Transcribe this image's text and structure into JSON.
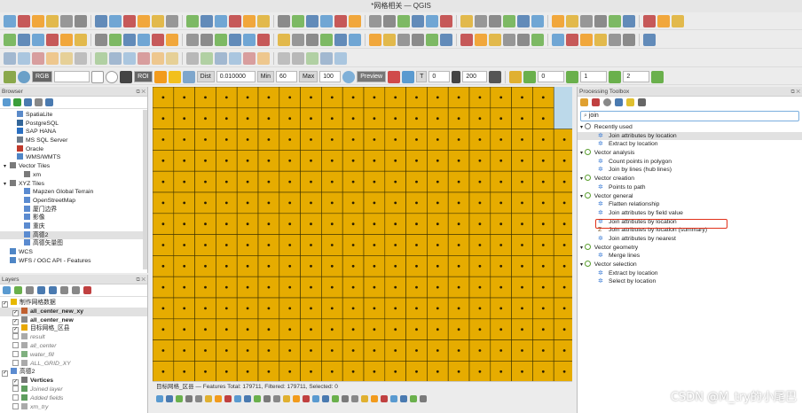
{
  "window": {
    "title": "*网格相关 — QGIS"
  },
  "raster_toolbar": {
    "band": "RGB",
    "roi": "ROI",
    "dist_label": "Dist",
    "dist_value": "0.010000",
    "min_label": "Min",
    "min_value": "60",
    "max_label": "Max",
    "max_value": "100",
    "preview": "Preview",
    "t_label": "T",
    "t_value": "0",
    "s_value": "200",
    "a_value": "0",
    "b_value": "1",
    "c_value": "2"
  },
  "browser": {
    "title": "Browser",
    "items": [
      {
        "label": "SpatiaLite",
        "color": "#5a8ac9",
        "indent": 1
      },
      {
        "label": "PostgreSQL",
        "color": "#336699",
        "indent": 1
      },
      {
        "label": "SAP HANA",
        "color": "#2a6fc1",
        "indent": 1
      },
      {
        "label": "MS SQL Server",
        "color": "#6d7b8a",
        "indent": 1
      },
      {
        "label": "Oracle",
        "color": "#c0392b",
        "indent": 1
      },
      {
        "label": "WMS/WMTS",
        "color": "#4f86c6",
        "indent": 1
      },
      {
        "label": "Vector Tiles",
        "color": "#7a7a7a",
        "indent": 0,
        "arrow": "▾"
      },
      {
        "label": "xm",
        "color": "#7a7a7a",
        "indent": 2
      },
      {
        "label": "XYZ Tiles",
        "color": "#7a7a7a",
        "indent": 0,
        "arrow": "▾"
      },
      {
        "label": "Mapzen Global Terrain",
        "color": "#5b8bd0",
        "indent": 2
      },
      {
        "label": "OpenStreetMap",
        "color": "#5b8bd0",
        "indent": 2
      },
      {
        "label": "厦门边界",
        "color": "#5b8bd0",
        "indent": 2
      },
      {
        "label": "影像",
        "color": "#5b8bd0",
        "indent": 2
      },
      {
        "label": "重庆",
        "color": "#5b8bd0",
        "indent": 2
      },
      {
        "label": "高德2",
        "color": "#5b8bd0",
        "indent": 2,
        "selected": true
      },
      {
        "label": "高德矢量图",
        "color": "#5b8bd0",
        "indent": 2
      },
      {
        "label": "WCS",
        "color": "#4f86c6",
        "indent": 0
      },
      {
        "label": "WFS / OGC API - Features",
        "color": "#4f86c6",
        "indent": 0
      }
    ]
  },
  "layers": {
    "title": "Layers",
    "items": [
      {
        "label": "制作网格数据",
        "checked": true,
        "bold": false,
        "italic": false,
        "color": "#e6b800",
        "indent": 0
      },
      {
        "label": "all_center_new_xy",
        "checked": true,
        "bold": true,
        "italic": false,
        "color": "#c06030",
        "indent": 1,
        "selected": true
      },
      {
        "label": "all_center_new",
        "checked": true,
        "bold": true,
        "italic": false,
        "color": "#888888",
        "indent": 1
      },
      {
        "label": "目标网格_区县",
        "checked": true,
        "bold": false,
        "italic": false,
        "color": "#e8a800",
        "indent": 1
      },
      {
        "label": "result",
        "checked": false,
        "bold": false,
        "italic": true,
        "color": "#aaaaaa",
        "indent": 1
      },
      {
        "label": "all_center",
        "checked": false,
        "bold": false,
        "italic": true,
        "color": "#aaaaaa",
        "indent": 1
      },
      {
        "label": "water_fill",
        "checked": false,
        "bold": false,
        "italic": true,
        "color": "#7fb07f",
        "indent": 1
      },
      {
        "label": "ALL_GRID_XY",
        "checked": false,
        "bold": false,
        "italic": true,
        "color": "#aaaaaa",
        "indent": 1
      },
      {
        "label": "高德2",
        "checked": true,
        "bold": false,
        "italic": false,
        "color": "#5b8bd0",
        "indent": 0
      },
      {
        "label": "Vertices",
        "checked": true,
        "bold": true,
        "italic": false,
        "color": "#777777",
        "indent": 1
      },
      {
        "label": "Joined layer",
        "checked": false,
        "bold": false,
        "italic": true,
        "color": "#5f9e5f",
        "indent": 1
      },
      {
        "label": "Added fields",
        "checked": false,
        "bold": false,
        "italic": true,
        "color": "#5f9e5f",
        "indent": 1
      },
      {
        "label": "xm_try",
        "checked": false,
        "bold": false,
        "italic": true,
        "color": "#aaaaaa",
        "indent": 1
      }
    ]
  },
  "toolbox": {
    "title": "Processing Toolbox",
    "search": "join",
    "items": [
      {
        "label": "Recently used",
        "group": true,
        "icon": "clock"
      },
      {
        "label": "Join attributes by location",
        "group": false,
        "selected": true
      },
      {
        "label": "Extract by location",
        "group": false
      },
      {
        "label": "Vector analysis",
        "group": true,
        "icon": "q"
      },
      {
        "label": "Count points in polygon",
        "group": false
      },
      {
        "label": "Join by lines (hub lines)",
        "group": false
      },
      {
        "label": "Vector creation",
        "group": true,
        "icon": "q"
      },
      {
        "label": "Points to path",
        "group": false
      },
      {
        "label": "Vector general",
        "group": true,
        "icon": "q"
      },
      {
        "label": "Flatten relationship",
        "group": false
      },
      {
        "label": "Join attributes by field value",
        "group": false
      },
      {
        "label": "Join attributes by location",
        "group": false,
        "boxed": true
      },
      {
        "label": "Join attributes by location (summary)",
        "group": false,
        "sigma": true
      },
      {
        "label": "Join attributes by nearest",
        "group": false
      },
      {
        "label": "Vector geometry",
        "group": true,
        "icon": "q"
      },
      {
        "label": "Merge lines",
        "group": false
      },
      {
        "label": "Vector selection",
        "group": true,
        "icon": "q"
      },
      {
        "label": "Extract by location",
        "group": false
      },
      {
        "label": "Select by location",
        "group": false
      }
    ]
  },
  "attribute_table": {
    "title": "目标网格_区县 — Features Total: 179711, Filtered: 179711, Selected: 0"
  },
  "map": {
    "fill": "#e6ac00",
    "sea": "#bcd9ea",
    "line": "#3a3000"
  },
  "watermark": "CSDN @M_try的小尾巴"
}
